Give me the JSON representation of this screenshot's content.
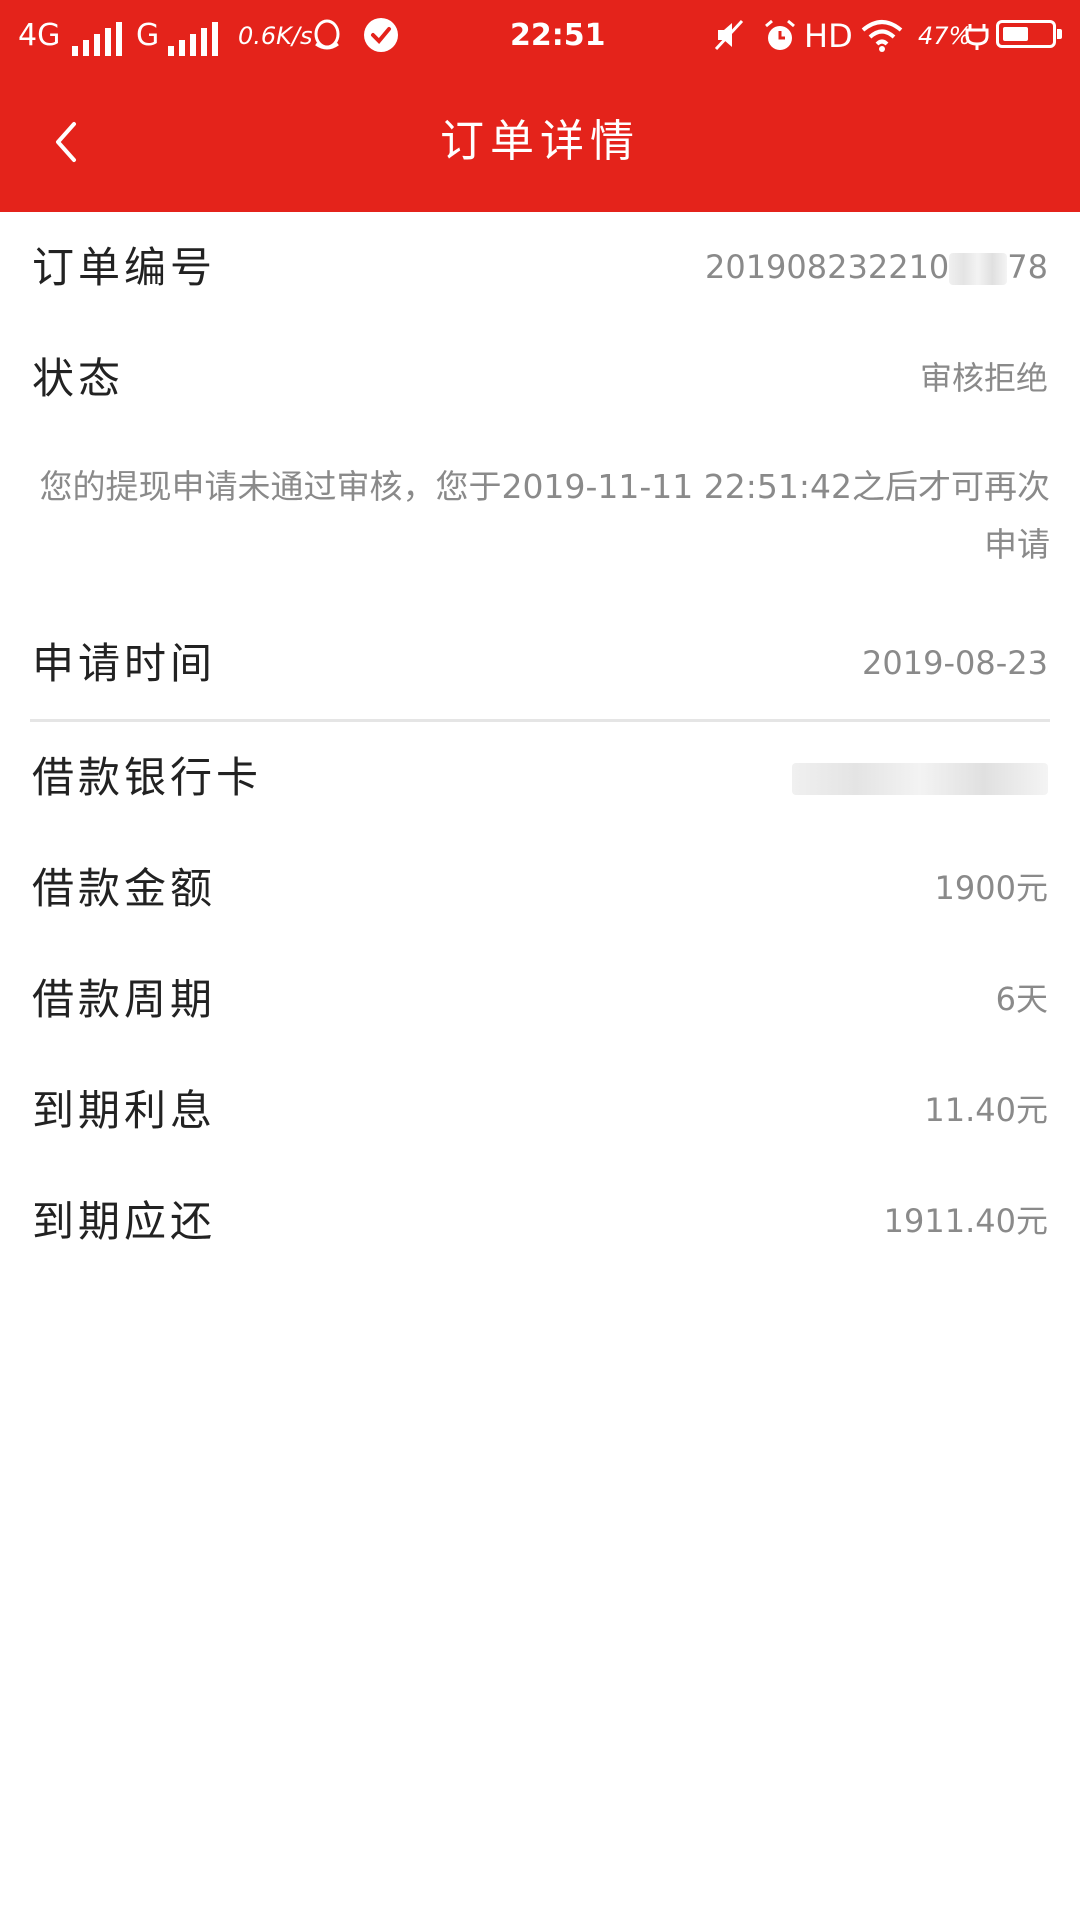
{
  "status_bar": {
    "network_1": "4G",
    "network_2": "G",
    "speed": "0.6K/s",
    "time": "22:51",
    "hd": "HD",
    "battery": "47%",
    "icons": [
      "signal-bars-icon",
      "qq-icon",
      "check-circle-icon",
      "mute-icon",
      "alarm-icon",
      "wifi-icon",
      "charging-plug-icon",
      "battery-icon"
    ]
  },
  "header": {
    "title": "订单详情",
    "back_icon": "chevron-left-icon"
  },
  "order": {
    "number_label": "订单编号",
    "number_value": "201908232210",
    "number_tail": "78",
    "status_label": "状态",
    "status_value": "审核拒绝",
    "status_note": "您的提现申请未通过审核，您于2019-11-11 22:51:42之后才可再次申请",
    "apply_time_label": "申请时间",
    "apply_time_value": "2019-08-23",
    "bank_card_label": "借款银行卡",
    "amount_label": "借款金额",
    "amount_value": "1900元",
    "period_label": "借款周期",
    "period_value": "6天",
    "interest_label": "到期利息",
    "interest_value": "11.40元",
    "repay_label": "到期应还",
    "repay_value": "1911.40元"
  },
  "colors": {
    "header_red": "#e4231b",
    "label_text": "#222222",
    "value_text": "#8a8a8a",
    "divider": "#e5e5e5"
  }
}
